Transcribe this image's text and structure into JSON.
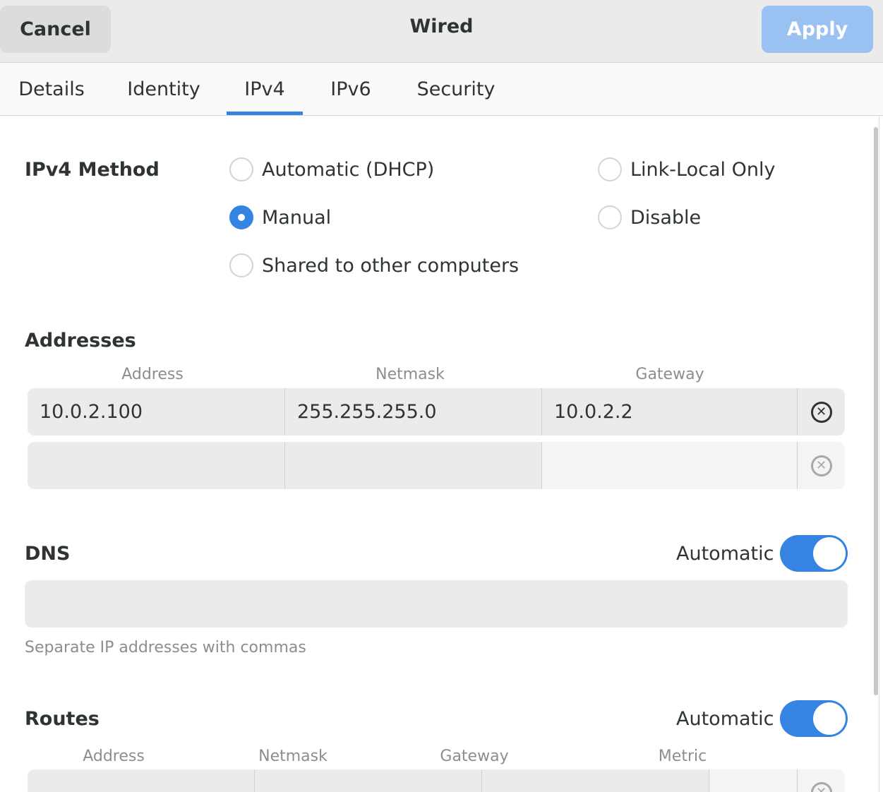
{
  "header": {
    "cancel_label": "Cancel",
    "title": "Wired",
    "apply_label": "Apply"
  },
  "tabs": [
    {
      "label": "Details",
      "active": false
    },
    {
      "label": "Identity",
      "active": false
    },
    {
      "label": "IPv4",
      "active": true
    },
    {
      "label": "IPv6",
      "active": false
    },
    {
      "label": "Security",
      "active": false
    }
  ],
  "ipv4_method": {
    "label": "IPv4 Method",
    "options": [
      {
        "label": "Automatic (DHCP)",
        "checked": false
      },
      {
        "label": "Link-Local Only",
        "checked": false
      },
      {
        "label": "Manual",
        "checked": true
      },
      {
        "label": "Disable",
        "checked": false
      },
      {
        "label": "Shared to other computers",
        "checked": false
      }
    ]
  },
  "addresses": {
    "heading": "Addresses",
    "columns": [
      "Address",
      "Netmask",
      "Gateway"
    ],
    "rows": [
      {
        "address": "10.0.2.100",
        "netmask": "255.255.255.0",
        "gateway": "10.0.2.2"
      },
      {
        "address": "",
        "netmask": "",
        "gateway": ""
      }
    ]
  },
  "dns": {
    "heading": "DNS",
    "automatic_label": "Automatic",
    "automatic_on": true,
    "entry_value": "",
    "hint": "Separate IP addresses with commas"
  },
  "routes": {
    "heading": "Routes",
    "automatic_label": "Automatic",
    "automatic_on": true,
    "columns": [
      "Address",
      "Netmask",
      "Gateway",
      "Metric"
    ]
  },
  "colors": {
    "accent": "#3584e4",
    "apply_disabled": "#99c1f1"
  }
}
